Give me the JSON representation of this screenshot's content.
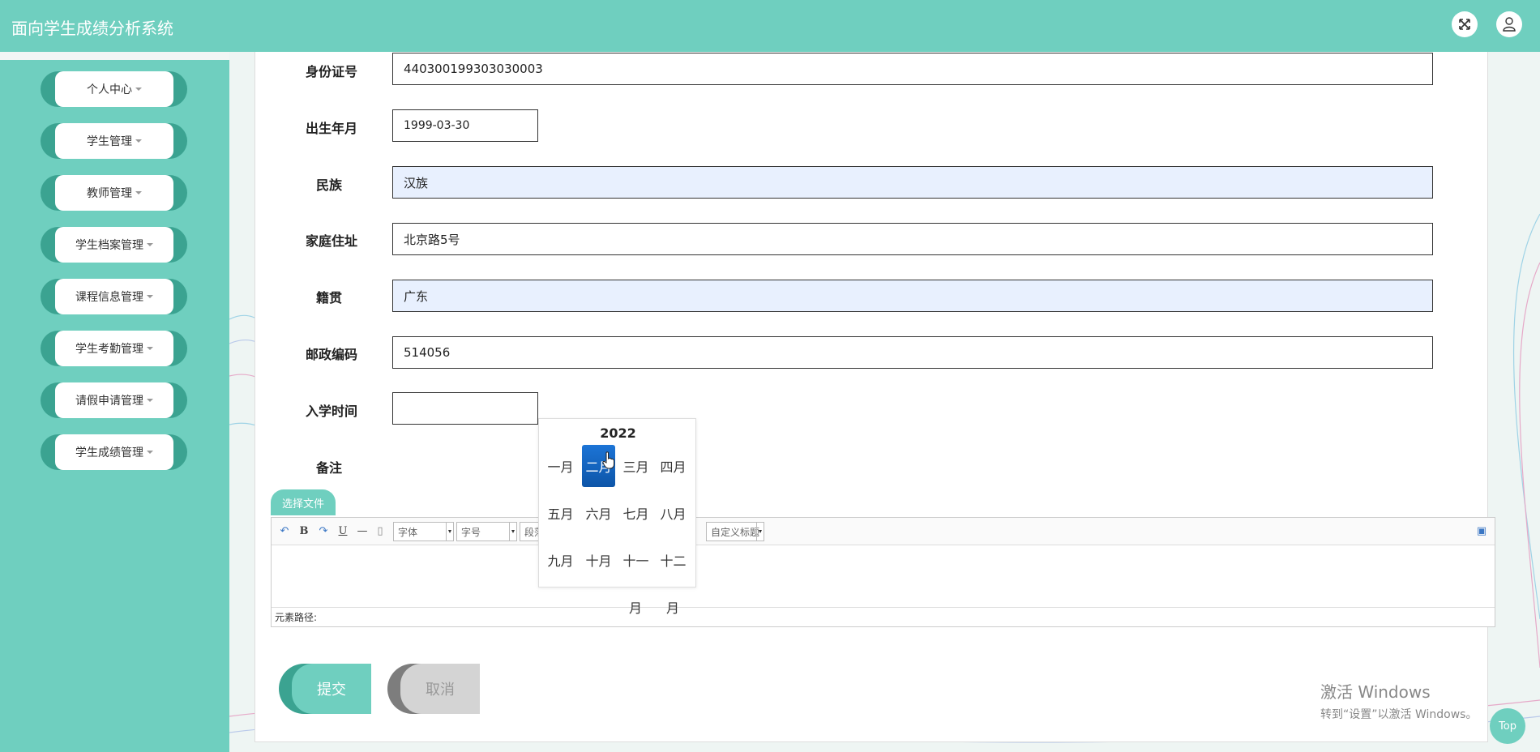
{
  "app": {
    "title": "面向学生成绩分析系统"
  },
  "header": {
    "fullscreen_icon": "expand-icon",
    "user_icon": "user-icon"
  },
  "sidebar": {
    "items": [
      {
        "label": "个人中心"
      },
      {
        "label": "学生管理"
      },
      {
        "label": "教师管理"
      },
      {
        "label": "学生档案管理"
      },
      {
        "label": "课程信息管理"
      },
      {
        "label": "学生考勤管理"
      },
      {
        "label": "请假申请管理"
      },
      {
        "label": "学生成绩管理"
      }
    ]
  },
  "form": {
    "id_number": {
      "label": "身份证号",
      "value": "440300199303030003"
    },
    "birth_date": {
      "label": "出生年月",
      "value": "1999-03-30"
    },
    "ethnicity": {
      "label": "民族",
      "value": "汉族"
    },
    "address": {
      "label": "家庭住址",
      "value": "北京路5号"
    },
    "native_place": {
      "label": "籍贯",
      "value": "广东"
    },
    "postal_code": {
      "label": "邮政编码",
      "value": "514056"
    },
    "enroll_time": {
      "label": "入学时间",
      "value": ""
    },
    "remark": {
      "label": "备注"
    }
  },
  "datepicker": {
    "year": "2022",
    "months": [
      "一月",
      "二月",
      "三月",
      "四月",
      "五月",
      "六月",
      "七月",
      "八月",
      "九月",
      "十月",
      "十一",
      "十二"
    ],
    "selected_index": 1,
    "overflow_tail": [
      "月",
      "月"
    ]
  },
  "editor": {
    "upload_label": "选择文件",
    "font_select": "字体",
    "size_select": "字号",
    "paragraph_select": "段落",
    "custom_title_select": "自定义标题",
    "path_label": "元素路径:",
    "toolbar_icons": [
      "undo-icon",
      "bold-icon",
      "redo-icon",
      "underline-icon",
      "horizontal-rule-icon",
      "document-icon",
      "source-view-icon"
    ]
  },
  "actions": {
    "submit_label": "提交",
    "cancel_label": "取消"
  },
  "watermark": {
    "line1": "激活 Windows",
    "line2": "转到“设置”以激活 Windows。"
  },
  "top_button": {
    "label": "Top"
  },
  "colors": {
    "primary": "#6fcfbf",
    "primary_dark": "#3ba391",
    "selected": "#1565c0",
    "input_autofill": "#e8f0fe"
  }
}
